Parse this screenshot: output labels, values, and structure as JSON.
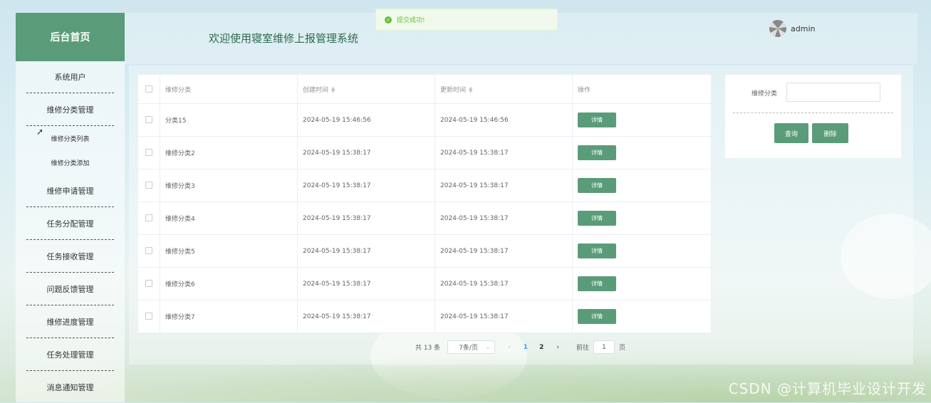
{
  "sidebar": {
    "brand": "后台首页",
    "items": [
      {
        "label": "系统用户"
      },
      {
        "label": "维修分类管理"
      },
      {
        "label": "维修分类列表"
      },
      {
        "label": "维修分类添加"
      },
      {
        "label": "维修申请管理"
      },
      {
        "label": "任务分配管理"
      },
      {
        "label": "任务接收管理"
      },
      {
        "label": "问题反馈管理"
      },
      {
        "label": "维修进度管理"
      },
      {
        "label": "任务处理管理"
      },
      {
        "label": "消息通知管理"
      }
    ]
  },
  "header": {
    "title": "欢迎使用寝室维修上报管理系统",
    "user": "admin"
  },
  "toast": {
    "message": "提交成功!"
  },
  "table": {
    "columns": {
      "category": "维修分类",
      "created": "创建时间",
      "updated": "更新时间",
      "action": "操作"
    },
    "action_label": "详情",
    "rows": [
      {
        "category": "分类15",
        "created": "2024-05-19 15:46:56",
        "updated": "2024-05-19 15:46:56"
      },
      {
        "category": "维修分类2",
        "created": "2024-05-19 15:38:17",
        "updated": "2024-05-19 15:38:17"
      },
      {
        "category": "维修分类3",
        "created": "2024-05-19 15:38:17",
        "updated": "2024-05-19 15:38:17"
      },
      {
        "category": "维修分类4",
        "created": "2024-05-19 15:38:17",
        "updated": "2024-05-19 15:38:17"
      },
      {
        "category": "维修分类5",
        "created": "2024-05-19 15:38:17",
        "updated": "2024-05-19 15:38:17"
      },
      {
        "category": "维修分类6",
        "created": "2024-05-19 15:38:17",
        "updated": "2024-05-19 15:38:17"
      },
      {
        "category": "维修分类7",
        "created": "2024-05-19 15:38:17",
        "updated": "2024-05-19 15:38:17"
      }
    ]
  },
  "search": {
    "label": "维修分类",
    "value": "",
    "query_button": "查询",
    "delete_button": "删除"
  },
  "pagination": {
    "total_text": "共 13 条",
    "page_size": "7条/页",
    "pages": [
      "1",
      "2"
    ],
    "current_page": "1",
    "goto_prefix": "前往",
    "goto_value": "1",
    "goto_suffix": "页"
  },
  "watermark": "CSDN @计算机毕业设计开发",
  "colors": {
    "primary": "#5a9c79",
    "success": "#67c23a",
    "page_active": "#409eff"
  }
}
